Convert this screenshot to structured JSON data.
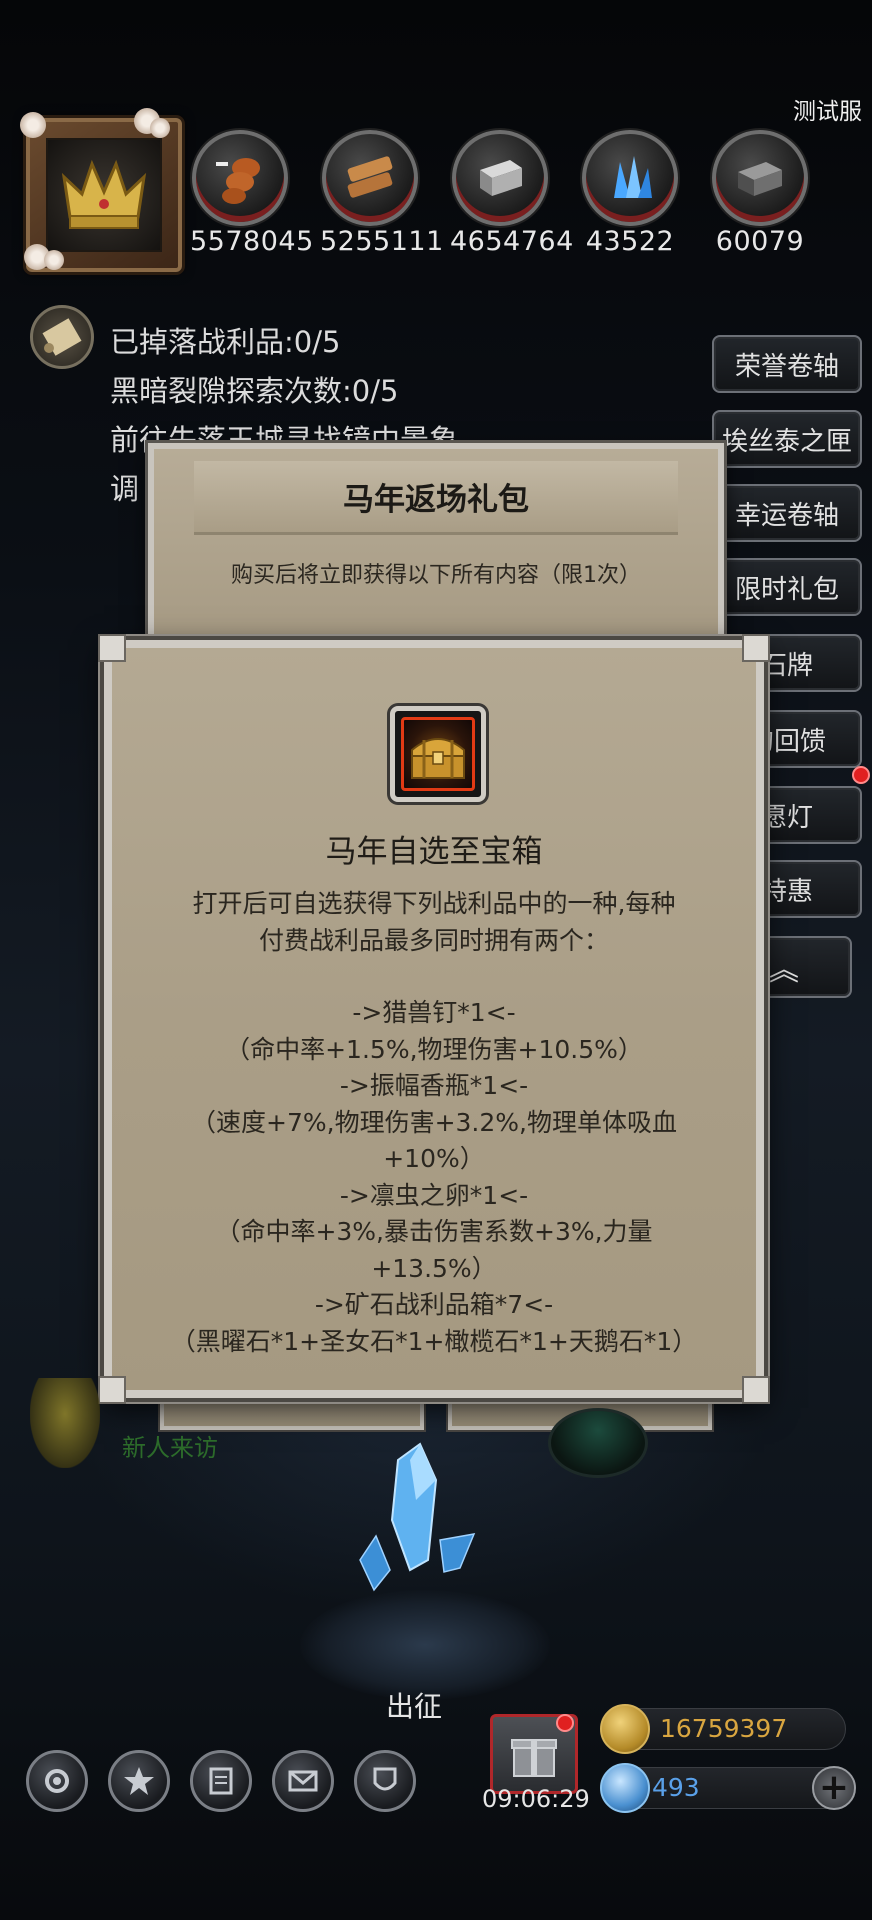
{
  "server_label": "测试服",
  "resources": [
    {
      "icon": "meat-icon",
      "value": "5578045"
    },
    {
      "icon": "wood-icon",
      "value": "5255111"
    },
    {
      "icon": "iron-icon",
      "value": "4654764"
    },
    {
      "icon": "crystal-icon",
      "value": "43522"
    },
    {
      "icon": "stone-icon",
      "value": "60079"
    }
  ],
  "tasks": [
    "已掉落战利品:0/5",
    "黑暗裂隙探索次数:0/5",
    "前往失落王城寻找镜中景象",
    "调"
  ],
  "side_buttons": [
    "荣誉卷轴",
    "埃丝泰之匣",
    "幸运卷轴",
    "限时礼包",
    "石牌",
    "的回馈",
    "愿灯",
    "特惠",
    "︽"
  ],
  "back_dialog": {
    "title": "马年返场礼包",
    "subtitle": "购买后将立即获得以下所有内容（限1次）"
  },
  "item_dialog": {
    "icon": "treasure-chest-icon",
    "name": "马年自选至宝箱",
    "description_lines": [
      "打开后可自选获得下列战利品中的一种,每种",
      "付费战利品最多同时拥有两个：",
      "",
      "->猎兽钉*1<-",
      "（命中率+1.5%,物理伤害+10.5%）",
      "->振幅香瓶*1<-",
      "（速度+7%,物理伤害+3.2%,物理单体吸血",
      "+10%）",
      "->凛虫之卵*1<-",
      "（命中率+3%,暴击伤害系数+3%,力量",
      "+13.5%）",
      "->矿石战利品箱*7<-",
      "（黑曜石*1+圣女石*1+橄榄石*1+天鹅石*1）"
    ]
  },
  "newcomer_label": "新人来访",
  "go_label": "出征",
  "timer": "09:06:29",
  "currency": {
    "gold": "16759397",
    "gems": "493"
  },
  "bottom_nav": [
    "settings-icon",
    "achievement-icon",
    "rank-icon",
    "mail-icon",
    "guild-icon"
  ],
  "colors": {
    "panel": "#aa9e87",
    "gold": "#d9a640",
    "gem": "#5aa0e8",
    "alert": "#e02020"
  }
}
